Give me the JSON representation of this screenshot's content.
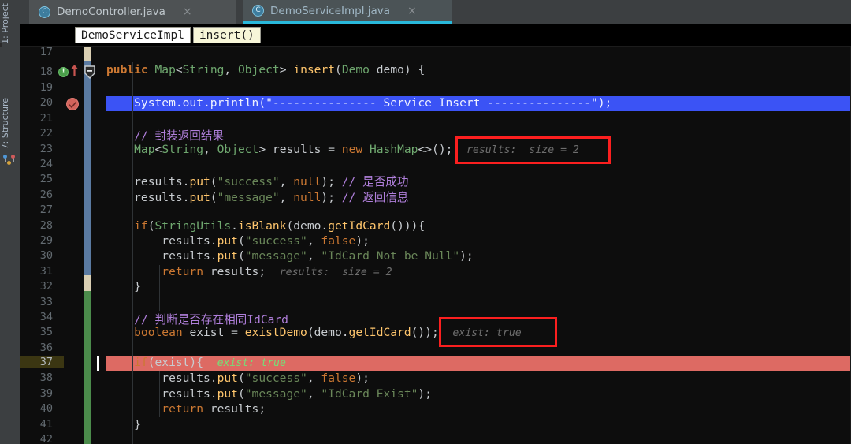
{
  "window": {
    "background": "#0d0d0d",
    "accent": "#29b8db"
  },
  "left_strip": {
    "tabs": [
      {
        "label": "1: Project",
        "icon": "project-folder-icon"
      },
      {
        "label": "7: Structure",
        "icon": "structure-nodes-icon"
      }
    ]
  },
  "tabs": [
    {
      "label": "DemoController.java",
      "icon": "java-class-icon",
      "badge": "C",
      "close": "×",
      "active": false
    },
    {
      "label": "DemoServiceImpl.java",
      "icon": "java-class-icon",
      "badge": "C",
      "close": "×",
      "active": true
    }
  ],
  "breadcrumb": {
    "items": [
      {
        "label": "DemoServiceImpl"
      },
      {
        "label": "insert()"
      }
    ]
  },
  "editor": {
    "first_line": 17,
    "last_line": 42,
    "lines": [
      {
        "n": 17,
        "text": ""
      },
      {
        "n": 18,
        "text": "    public Map<String, Object> insert(Demo demo) {"
      },
      {
        "n": 19,
        "text": ""
      },
      {
        "n": 20,
        "text": "        System.out.println(\"--------------- Service Insert ---------------\");"
      },
      {
        "n": 21,
        "text": ""
      },
      {
        "n": 22,
        "text": "        // 封装返回结果"
      },
      {
        "n": 23,
        "text": "        Map<String, Object> results = new HashMap<>();"
      },
      {
        "n": 24,
        "text": ""
      },
      {
        "n": 25,
        "text": "        results.put(\"success\", null); // 是否成功"
      },
      {
        "n": 26,
        "text": "        results.put(\"message\", null); // 返回信息"
      },
      {
        "n": 27,
        "text": ""
      },
      {
        "n": 28,
        "text": "        if(StringUtils.isBlank(demo.getIdCard())){"
      },
      {
        "n": 29,
        "text": "            results.put(\"success\", false);"
      },
      {
        "n": 30,
        "text": "            results.put(\"message\", \"IdCard Not be Null\");"
      },
      {
        "n": 31,
        "text": "            return results;"
      },
      {
        "n": 32,
        "text": "        }"
      },
      {
        "n": 33,
        "text": ""
      },
      {
        "n": 34,
        "text": "        // 判断是否存在相同IdCard"
      },
      {
        "n": 35,
        "text": "        boolean exist = existDemo(demo.getIdCard());"
      },
      {
        "n": 36,
        "text": ""
      },
      {
        "n": 37,
        "text": "        if(exist){"
      },
      {
        "n": 38,
        "text": "            results.put(\"success\", false);"
      },
      {
        "n": 39,
        "text": "            results.put(\"message\", \"IdCard Exist\");"
      },
      {
        "n": 40,
        "text": "            return results;"
      },
      {
        "n": 41,
        "text": "        }"
      },
      {
        "n": 42,
        "text": ""
      }
    ],
    "inline_hints": [
      {
        "line": 23,
        "text": "results:  size = 2",
        "style": "grey",
        "boxed": true
      },
      {
        "line": 31,
        "text": "results:  size = 2",
        "style": "grey",
        "boxed": false
      },
      {
        "line": 35,
        "text": "exist: true",
        "style": "grey",
        "boxed": true
      },
      {
        "line": 37,
        "text": "exist: true",
        "style": "green",
        "boxed": false
      }
    ],
    "highlights": [
      {
        "line": 20,
        "kind": "execution-point",
        "color": "#3b53f5"
      },
      {
        "line": 37,
        "kind": "breakpoint-line",
        "color": "#dd6a63"
      }
    ],
    "gutter_icons": [
      {
        "line": 18,
        "name": "run-method-icon"
      },
      {
        "line": 18,
        "name": "override-up-arrow-icon"
      },
      {
        "line": 18,
        "name": "fold-collapse-icon"
      },
      {
        "line": 20,
        "name": "breakpoint-verified-icon"
      }
    ],
    "vcs_changebar": [
      {
        "from": 17,
        "to": 17,
        "kind": "tan"
      },
      {
        "from": 18,
        "to": 31,
        "kind": "blue"
      },
      {
        "from": 32,
        "to": 32,
        "kind": "tan"
      },
      {
        "from": 33,
        "to": 42,
        "kind": "green"
      }
    ]
  },
  "annotations": {
    "color": "#fb1f1f",
    "boxes": [
      {
        "label": "results-size-annotation"
      },
      {
        "label": "exist-true-annotation"
      }
    ]
  }
}
